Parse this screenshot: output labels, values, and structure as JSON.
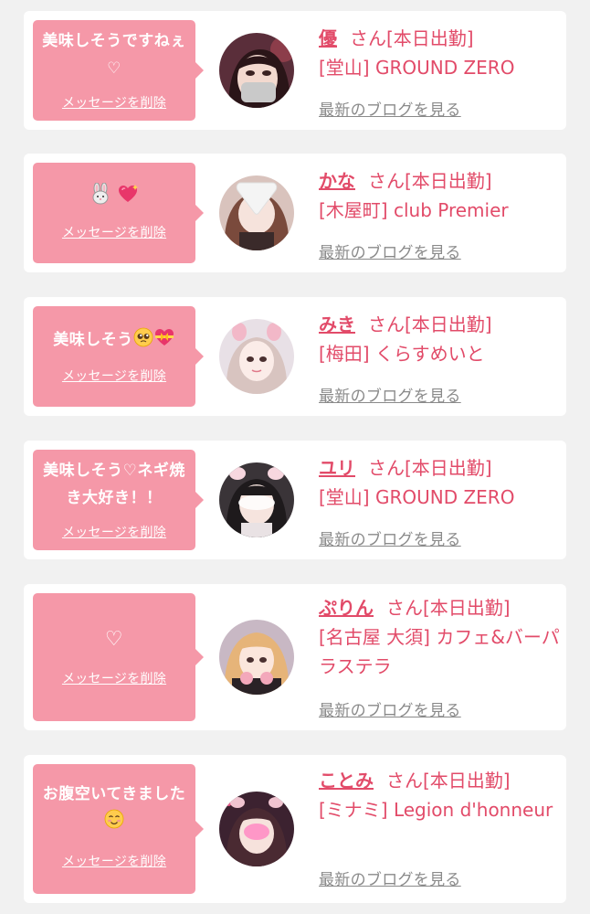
{
  "messages": [
    {
      "text": "美味しそうですねぇ♡",
      "delete_label": "メッセージを削除",
      "name": "優",
      "suffix": "さん[本日出勤]",
      "store": "[堂山] GROUND ZERO",
      "blog_label": "最新のブログを見る"
    },
    {
      "text": "",
      "emoji_names": [
        "rabbit-face-emoji",
        "sparkling-heart-emoji"
      ],
      "delete_label": "メッセージを削除",
      "name": "かな",
      "suffix": "さん[本日出勤]",
      "store": "[木屋町] club Premier",
      "blog_label": "最新のブログを見る"
    },
    {
      "text": "美味しそう",
      "emoji_names": [
        "pleading-face-emoji",
        "heart-with-ribbon-emoji"
      ],
      "delete_label": "メッセージを削除",
      "name": "みき",
      "suffix": "さん[本日出勤]",
      "store": "[梅田] くらすめいと",
      "blog_label": "最新のブログを見る"
    },
    {
      "text": "美味しそう♡ネギ焼き大好き！！",
      "delete_label": "メッセージを削除",
      "name": "ユリ",
      "suffix": "さん[本日出勤]",
      "store": "[堂山] GROUND ZERO",
      "blog_label": "最新のブログを見る"
    },
    {
      "text": "♡",
      "delete_label": "メッセージを削除",
      "name": "ぷりん",
      "suffix": "さん[本日出勤]",
      "store": "[名古屋 大須] カフェ&バーパラステラ",
      "blog_label": "最新のブログを見る"
    },
    {
      "text": "お腹空いてきました",
      "emoji_names": [
        "smiling-face-emoji"
      ],
      "delete_label": "メッセージを削除",
      "name": "ことみ",
      "suffix": "さん[本日出勤]",
      "store": "[ミナミ] Legion d'honneur",
      "blog_label": "最新のブログを見る"
    }
  ],
  "colors": {
    "page_background": "#f1f1f1",
    "bubble": "#f598a8",
    "name_accent": "#e24b69",
    "link_gray": "#8a8a8a"
  }
}
